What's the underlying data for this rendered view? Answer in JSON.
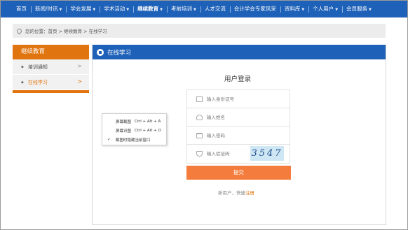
{
  "nav": {
    "items": [
      {
        "label": "首页",
        "dropdown": false,
        "active": false
      },
      {
        "label": "新闻/时讯",
        "dropdown": true,
        "active": false
      },
      {
        "label": "学会发展",
        "dropdown": true,
        "active": false
      },
      {
        "label": "学术活动",
        "dropdown": true,
        "active": false
      },
      {
        "label": "继续教育",
        "dropdown": true,
        "active": true
      },
      {
        "label": "考前培训",
        "dropdown": true,
        "active": false
      },
      {
        "label": "人才交流",
        "dropdown": false,
        "active": false
      },
      {
        "label": "会计学会专家风采",
        "dropdown": false,
        "active": false
      },
      {
        "label": "资料库",
        "dropdown": true,
        "active": false
      },
      {
        "label": "个人用户",
        "dropdown": true,
        "active": false
      },
      {
        "label": "会员服务",
        "dropdown": true,
        "active": false
      }
    ]
  },
  "breadcrumb": {
    "text": "您的位置：首页 > 继续教育 > 在线学习",
    "icon": "location-pin-icon"
  },
  "sidebar": {
    "title": "继续教育",
    "items": [
      {
        "label": "培训通知",
        "active": false
      },
      {
        "label": "在线学习",
        "active": true
      }
    ]
  },
  "panel": {
    "title": "在线学习",
    "icon": "panel-circle-icon"
  },
  "login": {
    "title": "用户登录",
    "fields": {
      "id_card_placeholder": "输入身份证号",
      "name_placeholder": "输入姓名",
      "password_placeholder": "输入密码",
      "captcha_placeholder": "输入验证码"
    },
    "captcha_text": "3547",
    "submit_label": "提交",
    "register_prefix": "新用户，快速",
    "register_link": "注册"
  },
  "context_menu": {
    "items": [
      {
        "label": "屏幕截图",
        "shortcut": "Ctrl + Alt + A",
        "checked": false
      },
      {
        "label": "屏幕识图",
        "shortcut": "Ctrl + Alt + O",
        "checked": false
      },
      {
        "label": "截图时隐藏当前窗口",
        "shortcut": "",
        "checked": true
      }
    ]
  },
  "colors": {
    "nav_blue": "#1e61b8",
    "accent_orange": "#e0740e",
    "submit_orange": "#f47c3c"
  }
}
